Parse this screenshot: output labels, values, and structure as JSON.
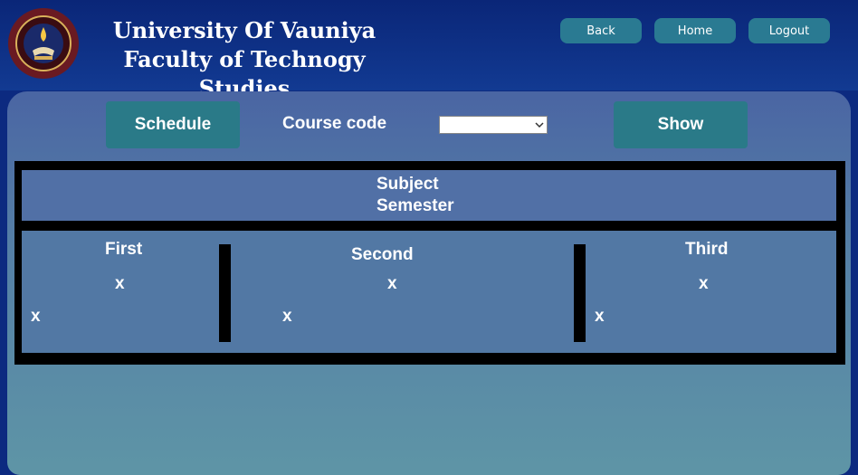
{
  "header": {
    "title_line1": "University Of Vauniya",
    "title_line2": "Faculty of Technogy Studies",
    "logo_icon": "university-crest-icon",
    "nav": {
      "back": "Back",
      "home": "Home",
      "logout": "Logout"
    }
  },
  "toolbar": {
    "schedule_label": "Schedule",
    "course_code_label": "Course code",
    "course_code_value": "",
    "show_label": "Show"
  },
  "table": {
    "subject_label": "Subject",
    "semester_label": "Semester",
    "columns": [
      {
        "heading": "First",
        "top_value": "x",
        "left_value": "x"
      },
      {
        "heading": "Second",
        "top_value": "x",
        "left_value": "x"
      },
      {
        "heading": "Third",
        "top_value": "x",
        "left_value": "x"
      }
    ]
  },
  "colors": {
    "header_bg": "#0c2a80",
    "button_teal": "#2a7a88",
    "panel_top": "#4a65a3",
    "panel_bottom": "#5e95a6"
  }
}
